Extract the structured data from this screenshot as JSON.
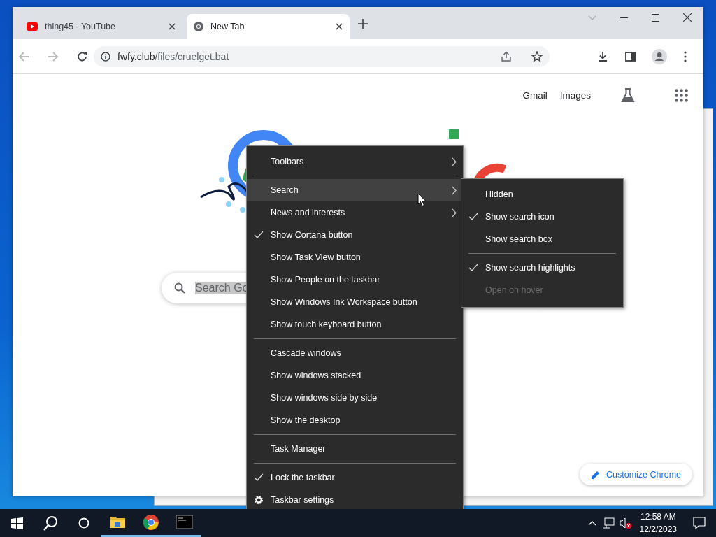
{
  "browser": {
    "tabs": [
      {
        "title": "thing45 - YouTube",
        "kind": "video",
        "selected": false
      },
      {
        "title": "New Tab",
        "kind": "chrome",
        "selected": true
      }
    ],
    "address": {
      "host": "fwfy.club",
      "path": "/files/cruelget.bat"
    },
    "top_links": [
      "Gmail",
      "Images"
    ],
    "search": {
      "value": "Search Go"
    },
    "customize_button": "Customize Chrome"
  },
  "context_menu": {
    "items": [
      {
        "kind": "item",
        "label": "Toolbars",
        "checked": false,
        "submenu": true,
        "selected": false
      },
      {
        "kind": "separator"
      },
      {
        "kind": "item",
        "label": "Search",
        "checked": false,
        "submenu": true,
        "selected": true
      },
      {
        "kind": "item",
        "label": "News and interests",
        "checked": false,
        "submenu": true,
        "selected": false
      },
      {
        "kind": "item",
        "label": "Show Cortana button",
        "checked": true,
        "submenu": false,
        "selected": false
      },
      {
        "kind": "item",
        "label": "Show Task View button",
        "checked": false,
        "submenu": false,
        "selected": false
      },
      {
        "kind": "item",
        "label": "Show People on the taskbar",
        "checked": false,
        "submenu": false,
        "selected": false
      },
      {
        "kind": "item",
        "label": "Show Windows Ink Workspace button",
        "checked": false,
        "submenu": false,
        "selected": false
      },
      {
        "kind": "item",
        "label": "Show touch keyboard button",
        "checked": false,
        "submenu": false,
        "selected": false
      },
      {
        "kind": "separator"
      },
      {
        "kind": "item",
        "label": "Cascade windows",
        "checked": false,
        "submenu": false,
        "selected": false
      },
      {
        "kind": "item",
        "label": "Show windows stacked",
        "checked": false,
        "submenu": false,
        "selected": false
      },
      {
        "kind": "item",
        "label": "Show windows side by side",
        "checked": false,
        "submenu": false,
        "selected": false
      },
      {
        "kind": "item",
        "label": "Show the desktop",
        "checked": false,
        "submenu": false,
        "selected": false
      },
      {
        "kind": "separator"
      },
      {
        "kind": "item",
        "label": "Task Manager",
        "checked": false,
        "submenu": false,
        "selected": false
      },
      {
        "kind": "separator"
      },
      {
        "kind": "item",
        "label": "Lock the taskbar",
        "checked": true,
        "submenu": false,
        "selected": false
      },
      {
        "kind": "settings",
        "label": "Taskbar settings",
        "checked": false,
        "submenu": false,
        "selected": false
      }
    ]
  },
  "search_submenu": {
    "items": [
      {
        "kind": "item",
        "label": "Hidden",
        "checked": false,
        "disabled": false
      },
      {
        "kind": "item",
        "label": "Show search icon",
        "checked": true,
        "disabled": false
      },
      {
        "kind": "item",
        "label": "Show search box",
        "checked": false,
        "disabled": false
      },
      {
        "kind": "separator"
      },
      {
        "kind": "item",
        "label": "Show search highlights",
        "checked": true,
        "disabled": false
      },
      {
        "kind": "item",
        "label": "Open on hover",
        "checked": false,
        "disabled": true
      }
    ]
  },
  "taskbar": {
    "time": "12:58 AM",
    "date": "12/2/2023"
  }
}
